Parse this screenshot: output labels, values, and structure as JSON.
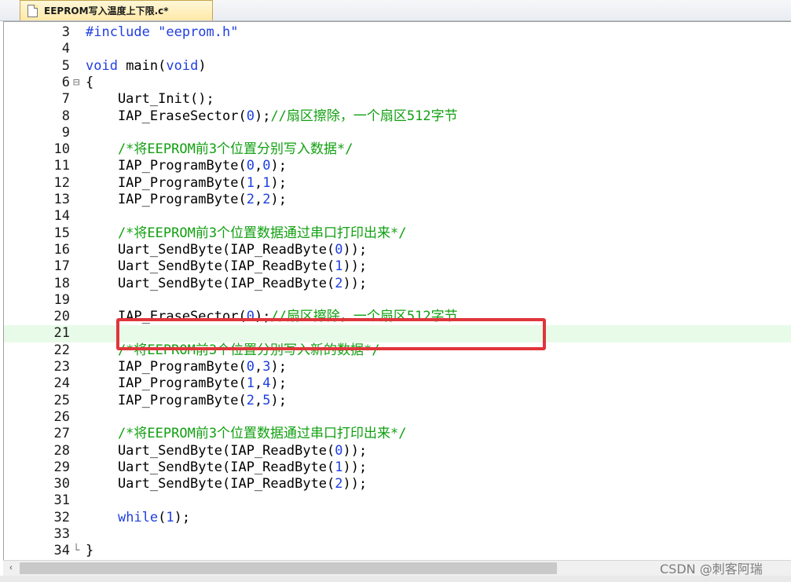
{
  "tab": {
    "label": "EEPROM写入温度上下限.c*",
    "icon": "file-icon"
  },
  "editor": {
    "current_line": "21",
    "lines": [
      {
        "num": "3",
        "code": [
          {
            "t": "#include ",
            "c": "pre"
          },
          {
            "t": "\"eeprom.h\"",
            "c": "str"
          }
        ]
      },
      {
        "num": "4",
        "code": []
      },
      {
        "num": "5",
        "code": [
          {
            "t": "void",
            "c": "kw"
          },
          {
            "t": " main(",
            "c": ""
          },
          {
            "t": "void",
            "c": "kw"
          },
          {
            "t": ")",
            "c": ""
          }
        ]
      },
      {
        "num": "6",
        "fold": "⊟",
        "code": [
          {
            "t": "{",
            "c": ""
          }
        ]
      },
      {
        "num": "7",
        "code": [
          {
            "t": "    Uart_Init();",
            "c": ""
          }
        ]
      },
      {
        "num": "8",
        "code": [
          {
            "t": "    IAP_EraseSector(",
            "c": ""
          },
          {
            "t": "0",
            "c": "num"
          },
          {
            "t": ");",
            "c": ""
          },
          {
            "t": "//扇区擦除，一个扇区512字节",
            "c": "cmt"
          }
        ]
      },
      {
        "num": "9",
        "code": []
      },
      {
        "num": "10",
        "code": [
          {
            "t": "    /*将EEPROM前3个位置分别写入数据*/",
            "c": "cmt"
          }
        ]
      },
      {
        "num": "11",
        "code": [
          {
            "t": "    IAP_ProgramByte(",
            "c": ""
          },
          {
            "t": "0",
            "c": "num"
          },
          {
            "t": ",",
            "c": ""
          },
          {
            "t": "0",
            "c": "num"
          },
          {
            "t": ");",
            "c": ""
          }
        ]
      },
      {
        "num": "12",
        "code": [
          {
            "t": "    IAP_ProgramByte(",
            "c": ""
          },
          {
            "t": "1",
            "c": "num"
          },
          {
            "t": ",",
            "c": ""
          },
          {
            "t": "1",
            "c": "num"
          },
          {
            "t": ");",
            "c": ""
          }
        ]
      },
      {
        "num": "13",
        "code": [
          {
            "t": "    IAP_ProgramByte(",
            "c": ""
          },
          {
            "t": "2",
            "c": "num"
          },
          {
            "t": ",",
            "c": ""
          },
          {
            "t": "2",
            "c": "num"
          },
          {
            "t": ");",
            "c": ""
          }
        ]
      },
      {
        "num": "14",
        "code": []
      },
      {
        "num": "15",
        "code": [
          {
            "t": "    /*将EEPROM前3个位置数据通过串口打印出来*/",
            "c": "cmt"
          }
        ]
      },
      {
        "num": "16",
        "code": [
          {
            "t": "    Uart_SendByte(IAP_ReadByte(",
            "c": ""
          },
          {
            "t": "0",
            "c": "num"
          },
          {
            "t": "));",
            "c": ""
          }
        ]
      },
      {
        "num": "17",
        "code": [
          {
            "t": "    Uart_SendByte(IAP_ReadByte(",
            "c": ""
          },
          {
            "t": "1",
            "c": "num"
          },
          {
            "t": "));",
            "c": ""
          }
        ]
      },
      {
        "num": "18",
        "code": [
          {
            "t": "    Uart_SendByte(IAP_ReadByte(",
            "c": ""
          },
          {
            "t": "2",
            "c": "num"
          },
          {
            "t": "));",
            "c": ""
          }
        ]
      },
      {
        "num": "19",
        "code": []
      },
      {
        "num": "20",
        "code": [
          {
            "t": "    IAP_EraseSector(",
            "c": ""
          },
          {
            "t": "0",
            "c": "num"
          },
          {
            "t": ");",
            "c": ""
          },
          {
            "t": "//扇区擦除，一个扇区512字节",
            "c": "cmt"
          }
        ]
      },
      {
        "num": "21",
        "code": []
      },
      {
        "num": "22",
        "code": [
          {
            "t": "    /*将EEPROM前3个位置分别写入新的数据*/",
            "c": "cmt"
          }
        ]
      },
      {
        "num": "23",
        "code": [
          {
            "t": "    IAP_ProgramByte(",
            "c": ""
          },
          {
            "t": "0",
            "c": "num"
          },
          {
            "t": ",",
            "c": ""
          },
          {
            "t": "3",
            "c": "num"
          },
          {
            "t": ");",
            "c": ""
          }
        ]
      },
      {
        "num": "24",
        "code": [
          {
            "t": "    IAP_ProgramByte(",
            "c": ""
          },
          {
            "t": "1",
            "c": "num"
          },
          {
            "t": ",",
            "c": ""
          },
          {
            "t": "4",
            "c": "num"
          },
          {
            "t": ");",
            "c": ""
          }
        ]
      },
      {
        "num": "25",
        "code": [
          {
            "t": "    IAP_ProgramByte(",
            "c": ""
          },
          {
            "t": "2",
            "c": "num"
          },
          {
            "t": ",",
            "c": ""
          },
          {
            "t": "5",
            "c": "num"
          },
          {
            "t": ");",
            "c": ""
          }
        ]
      },
      {
        "num": "26",
        "code": []
      },
      {
        "num": "27",
        "code": [
          {
            "t": "    /*将EEPROM前3个位置数据通过串口打印出来*/",
            "c": "cmt"
          }
        ]
      },
      {
        "num": "28",
        "code": [
          {
            "t": "    Uart_SendByte(IAP_ReadByte(",
            "c": ""
          },
          {
            "t": "0",
            "c": "num"
          },
          {
            "t": "));",
            "c": ""
          }
        ]
      },
      {
        "num": "29",
        "code": [
          {
            "t": "    Uart_SendByte(IAP_ReadByte(",
            "c": ""
          },
          {
            "t": "1",
            "c": "num"
          },
          {
            "t": "));",
            "c": ""
          }
        ]
      },
      {
        "num": "30",
        "code": [
          {
            "t": "    Uart_SendByte(IAP_ReadByte(",
            "c": ""
          },
          {
            "t": "2",
            "c": "num"
          },
          {
            "t": "));",
            "c": ""
          }
        ]
      },
      {
        "num": "31",
        "code": []
      },
      {
        "num": "32",
        "code": [
          {
            "t": "    ",
            "c": ""
          },
          {
            "t": "while",
            "c": "kw"
          },
          {
            "t": "(",
            "c": ""
          },
          {
            "t": "1",
            "c": "num"
          },
          {
            "t": ");",
            "c": ""
          }
        ]
      },
      {
        "num": "33",
        "code": []
      },
      {
        "num": "34",
        "fold": "└",
        "code": [
          {
            "t": "}",
            "c": ""
          }
        ]
      }
    ]
  },
  "highlight": {
    "line": "20",
    "color": "#e0353b"
  },
  "scrollbar": {
    "left_arrow": "‹",
    "position": 0
  },
  "watermark": {
    "text": "CSDN @刺客阿瑞"
  }
}
